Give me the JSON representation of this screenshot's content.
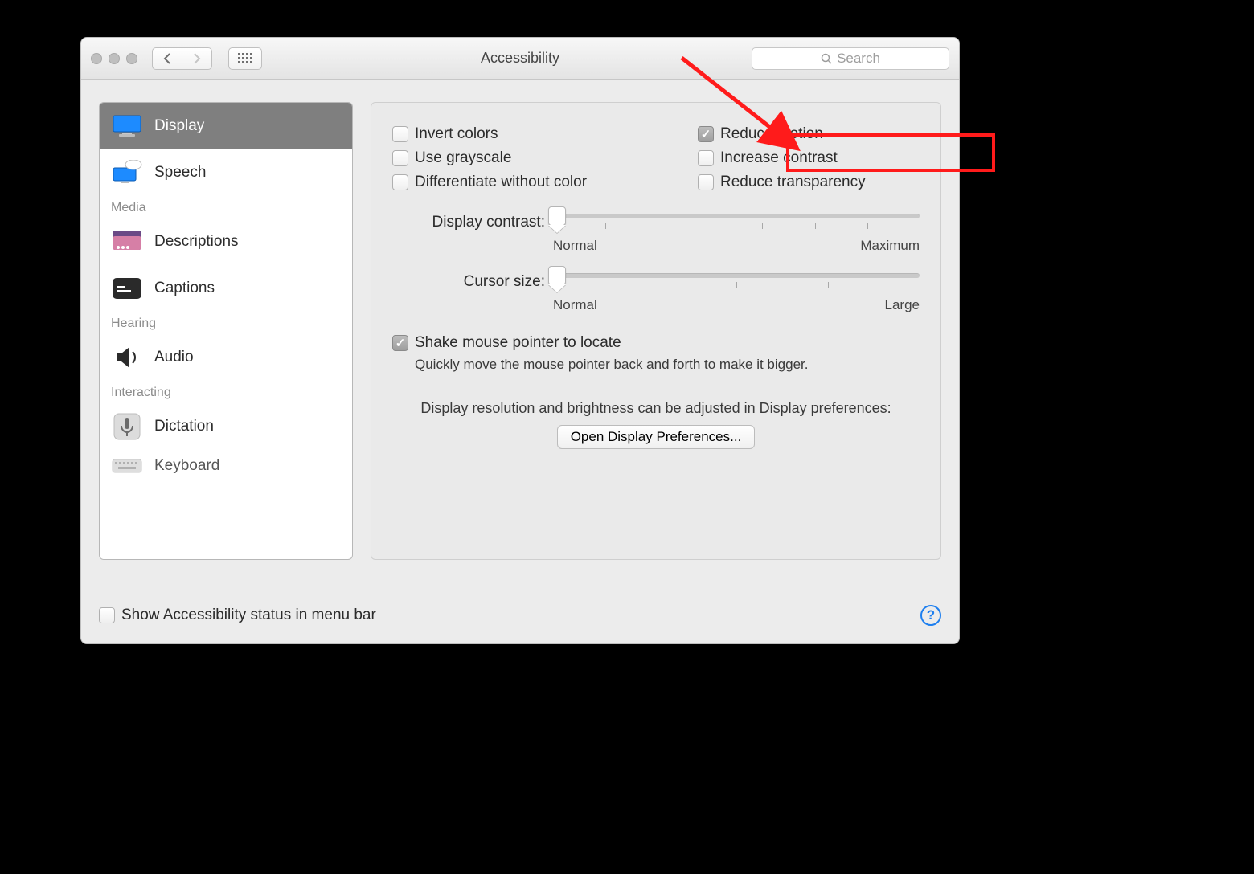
{
  "window": {
    "title": "Accessibility",
    "search_placeholder": "Search"
  },
  "sidebar": {
    "items": [
      {
        "label": "Display",
        "icon": "display-icon"
      },
      {
        "label": "Speech",
        "icon": "speech-icon"
      },
      {
        "label": "Descriptions",
        "icon": "descriptions-icon"
      },
      {
        "label": "Captions",
        "icon": "captions-icon"
      },
      {
        "label": "Audio",
        "icon": "audio-icon"
      },
      {
        "label": "Dictation",
        "icon": "dictation-icon"
      },
      {
        "label": "Keyboard",
        "icon": "keyboard-icon"
      }
    ],
    "sections": {
      "media": "Media",
      "hearing": "Hearing",
      "interacting": "Interacting"
    },
    "selected_index": 0
  },
  "panel": {
    "left_checks": [
      {
        "label": "Invert colors",
        "checked": false
      },
      {
        "label": "Use grayscale",
        "checked": false
      },
      {
        "label": "Differentiate without color",
        "checked": false
      }
    ],
    "right_checks": [
      {
        "label": "Reduce motion",
        "checked": true
      },
      {
        "label": "Increase contrast",
        "checked": false
      },
      {
        "label": "Reduce transparency",
        "checked": false
      }
    ],
    "sliders": {
      "display_contrast": {
        "label": "Display contrast:",
        "min_label": "Normal",
        "max_label": "Maximum",
        "value": 0
      },
      "cursor_size": {
        "label": "Cursor size:",
        "min_label": "Normal",
        "max_label": "Large",
        "value": 0
      }
    },
    "shake": {
      "label": "Shake mouse pointer to locate",
      "checked": true,
      "help": "Quickly move the mouse pointer back and forth to make it bigger."
    },
    "note": "Display resolution and brightness can be adjusted in Display preferences:",
    "open_button": "Open Display Preferences..."
  },
  "footer": {
    "show_status_label": "Show Accessibility status in menu bar",
    "show_status_checked": false
  },
  "annotation": {
    "highlight_target": "reduce-motion-checkbox"
  }
}
